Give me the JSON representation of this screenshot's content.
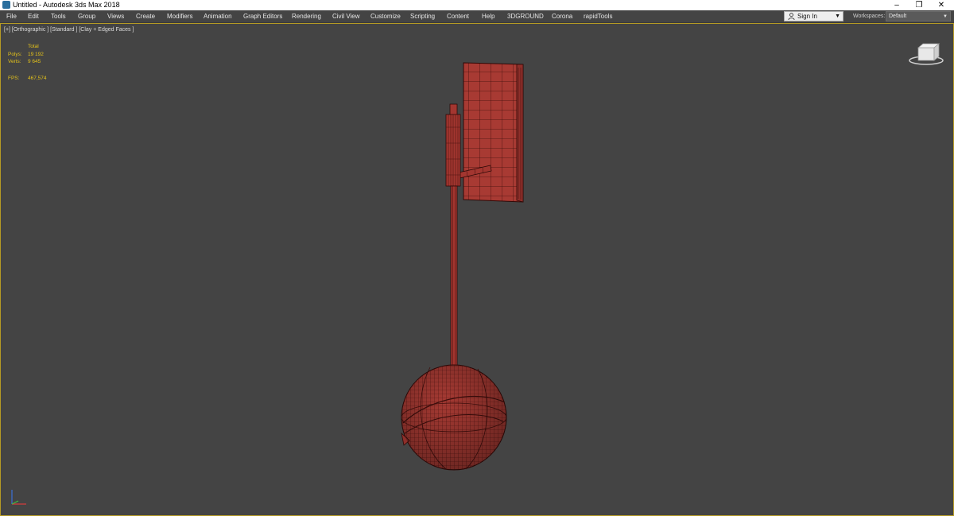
{
  "window": {
    "title": "Untitled - Autodesk 3ds Max 2018"
  },
  "menu": [
    "File",
    "Edit",
    "Tools",
    "Group",
    "Views",
    "Create",
    "Modifiers",
    "Animation",
    "Graph Editors",
    "Rendering",
    "Civil View",
    "Customize",
    "Scripting",
    "Content",
    "Help",
    "3DGROUND",
    "Corona",
    "rapidTools"
  ],
  "account": {
    "sign_in_label": "Sign In"
  },
  "workspaces": {
    "label": "Workspaces:",
    "value": "Default"
  },
  "viewport": {
    "label": "[+] [Orthographic ] [Standard ] [Clay + Edged Faces ]",
    "stats": {
      "total_header": "Total",
      "polys_label": "Polys:",
      "polys_value": "19 192",
      "verts_label": "Verts:",
      "verts_value": "9 645",
      "fps_label": "FPS:",
      "fps_value": "467,574"
    }
  },
  "colors": {
    "accent_border": "#b59a24",
    "stat_text": "#e4c21a",
    "model_fill": "#a83a33",
    "model_wire": "#3d0d0b"
  }
}
